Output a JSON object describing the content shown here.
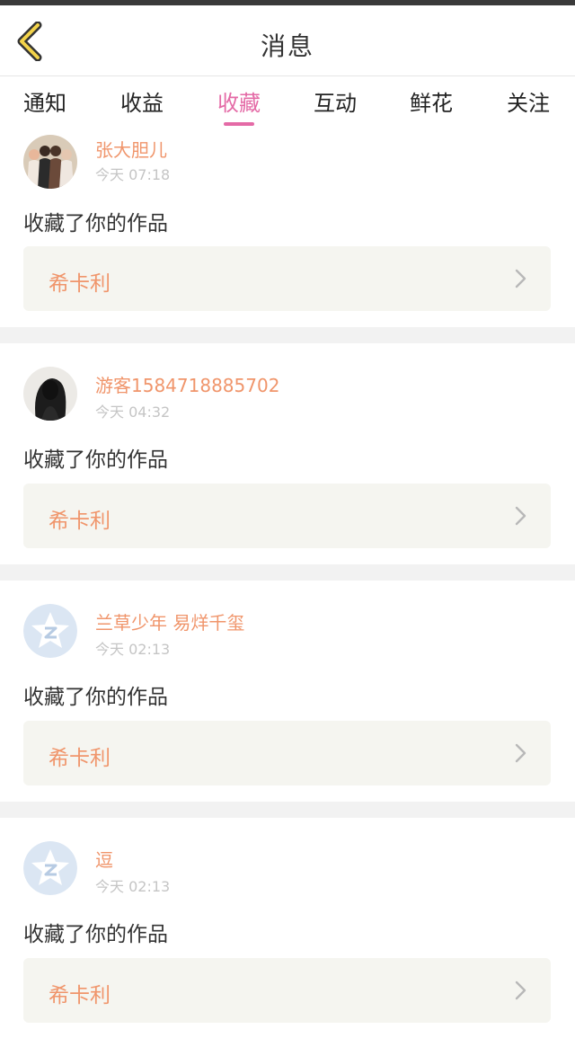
{
  "header": {
    "title": "消息"
  },
  "tabs": [
    {
      "label": "通知"
    },
    {
      "label": "收益"
    },
    {
      "label": "收藏"
    },
    {
      "label": "互动"
    },
    {
      "label": "鲜花"
    },
    {
      "label": "关注"
    }
  ],
  "active_tab": "收藏",
  "colors": {
    "accent": "#e46aa6",
    "name": "#f0956b",
    "time": "#c5c5c5",
    "card_bg": "#f5f5f0"
  },
  "items": [
    {
      "name": "张大胆儿",
      "time": "今天 07:18",
      "action": "收藏了你的作品",
      "work": "希卡利",
      "avatar": "group-photo"
    },
    {
      "name": "游客1584718885702",
      "time": "今天 04:32",
      "action": "收藏了你的作品",
      "work": "希卡利",
      "avatar": "girl-photo"
    },
    {
      "name": "兰草少年 易烊千玺",
      "time": "今天 02:13",
      "action": "收藏了你的作品",
      "work": "希卡利",
      "avatar": "default-star-avatar"
    },
    {
      "name": "逗",
      "time": "今天 02:13",
      "action": "收藏了你的作品",
      "work": "希卡利",
      "avatar": "default-star-avatar"
    }
  ]
}
